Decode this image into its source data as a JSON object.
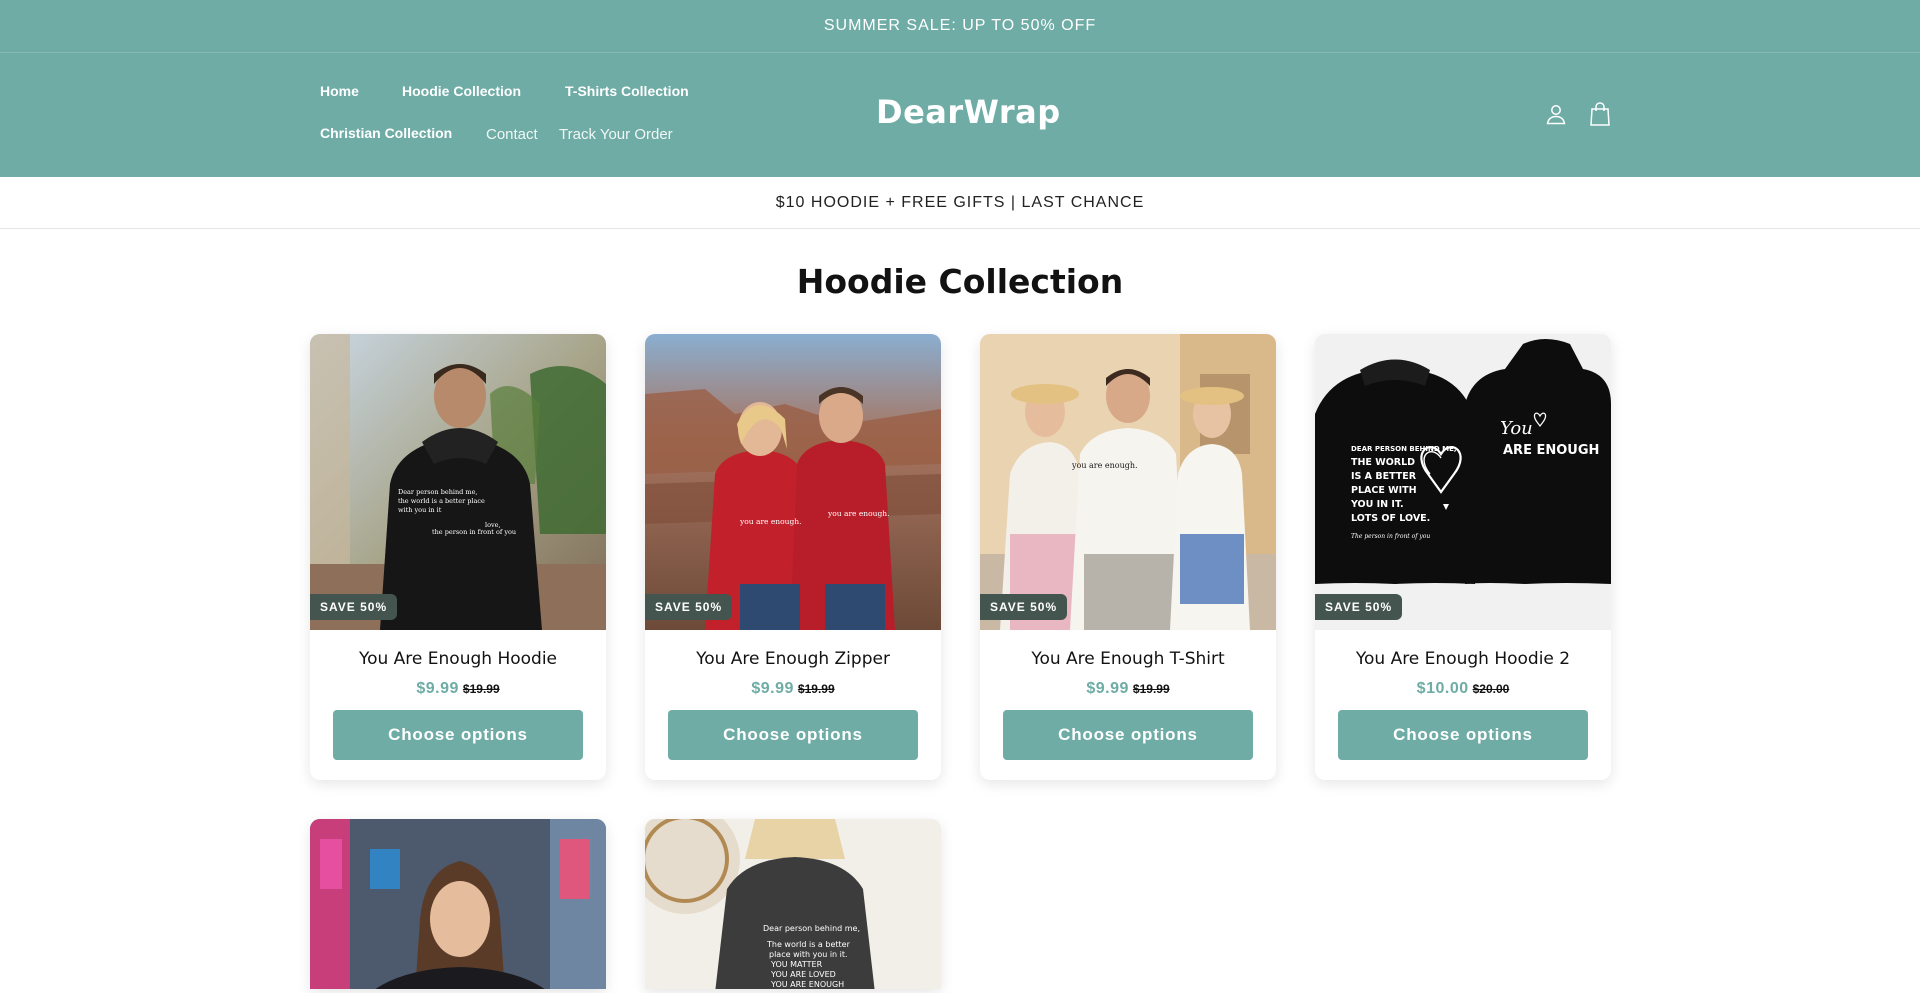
{
  "announcement_top": "SUMMER SALE: UP TO 50% OFF",
  "header": {
    "logo": "DearWrap",
    "nav": [
      {
        "label": "Home"
      },
      {
        "label": "Hoodie Collection"
      },
      {
        "label": "T-Shirts Collection"
      },
      {
        "label": "Christian Collection"
      },
      {
        "label": "Contact"
      },
      {
        "label": "Track Your Order"
      }
    ],
    "icons": [
      "account-icon",
      "cart-icon"
    ]
  },
  "announcement_sub": "$10 HOODIE + FREE GIFTS | LAST CHANCE",
  "collection_title": "Hoodie Collection",
  "colors": {
    "brand": "#6eaca5",
    "badge": "#445550"
  },
  "products": [
    {
      "name": "You Are Enough Hoodie",
      "badge": "SAVE 50%",
      "price": "$9.99",
      "compare_price": "$19.99",
      "button": "Choose options"
    },
    {
      "name": "You Are Enough Zipper",
      "badge": "SAVE 50%",
      "price": "$9.99",
      "compare_price": "$19.99",
      "button": "Choose options"
    },
    {
      "name": "You Are Enough T-Shirt",
      "badge": "SAVE 50%",
      "price": "$9.99",
      "compare_price": "$19.99",
      "button": "Choose options"
    },
    {
      "name": "You Are Enough Hoodie 2",
      "badge": "SAVE 50%",
      "price": "$10.00",
      "compare_price": "$20.00",
      "button": "Choose options"
    }
  ],
  "product_images": {
    "hoodie_back_lines": [
      "Dear person behind me,",
      "the world is a better place",
      "with you in it",
      "love,",
      "the person in front of you"
    ],
    "zipper_text": "you are enough.",
    "tshirt_text": "you are enough.",
    "hoodie2_left_lines": [
      "DEAR PERSON BEHIND ME,",
      "THE WORLD",
      "IS A BETTER",
      "PLACE WITH",
      "YOU IN IT.",
      "LOTS OF LOVE."
    ],
    "hoodie2_left_footer": "The person in front of you",
    "hoodie2_right_top": "You",
    "hoodie2_right_bottom": "ARE ENOUGH",
    "tshirt2_lines": [
      "Dear person behind me,",
      "The world is a better",
      "place with you in it.",
      "YOU MATTER",
      "YOU ARE LOVED",
      "YOU ARE ENOUGH"
    ]
  }
}
